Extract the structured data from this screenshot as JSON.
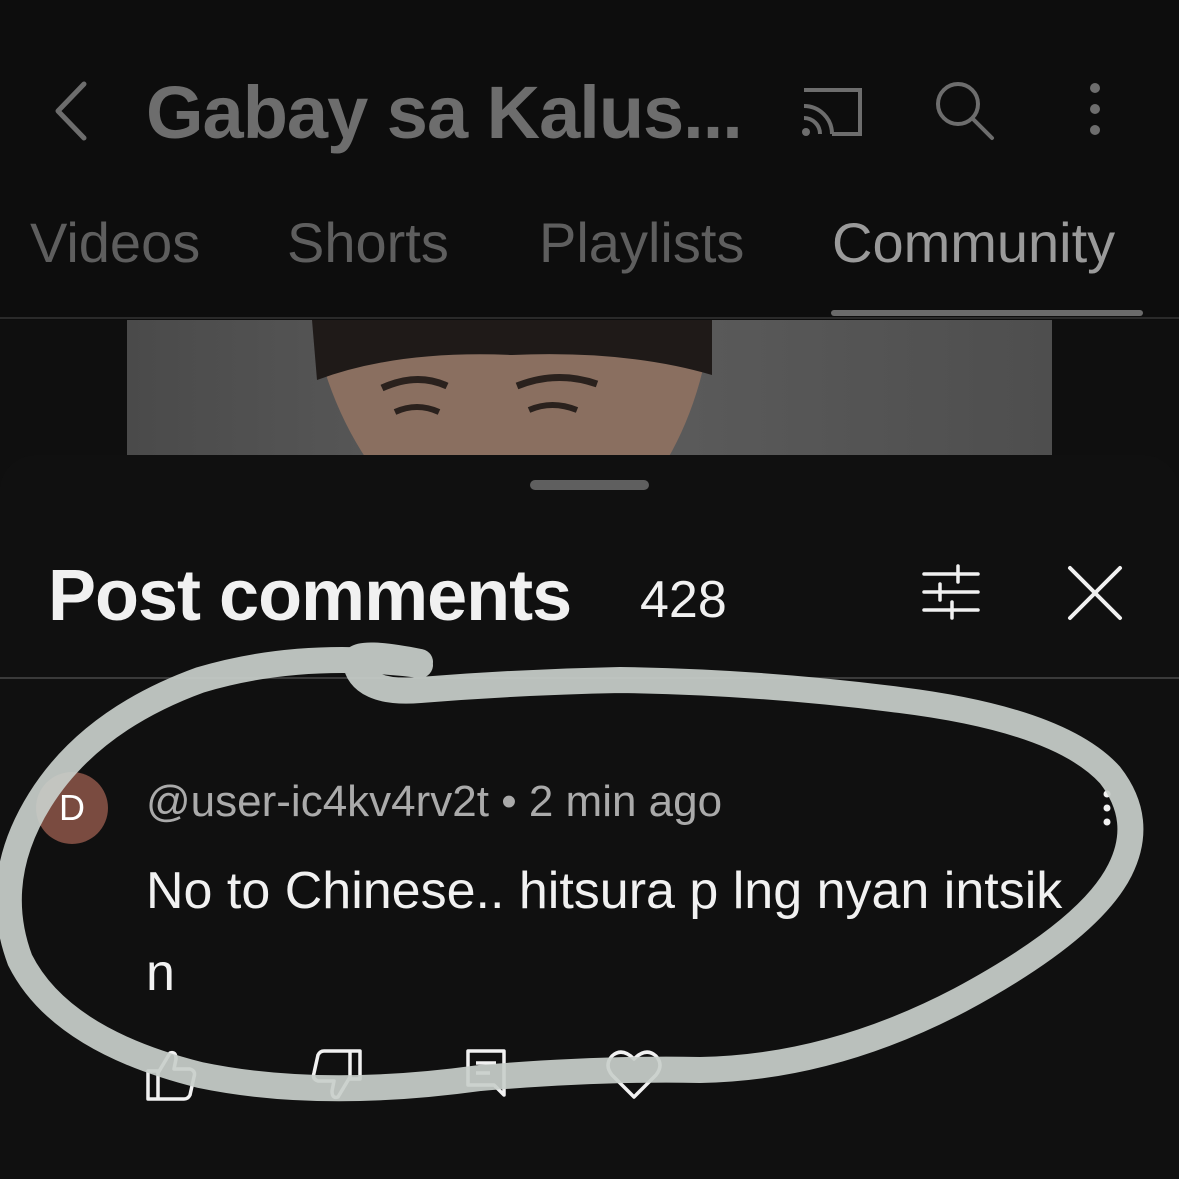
{
  "header": {
    "channel_title": "Gabay sa Kalus...",
    "icons": [
      "back-arrow-icon",
      "cast-icon",
      "search-icon",
      "more-vert-icon"
    ]
  },
  "tabs": [
    {
      "label": "Videos",
      "active": false
    },
    {
      "label": "Shorts",
      "active": false
    },
    {
      "label": "Playlists",
      "active": false
    },
    {
      "label": "Community",
      "active": true
    }
  ],
  "sheet": {
    "title": "Post comments",
    "count": "428",
    "icons": [
      "filter-icon",
      "close-icon"
    ]
  },
  "comment": {
    "avatar_letter": "D",
    "avatar_color": "#7a4b40",
    "author": "@user-ic4kv4rv2t",
    "separator": "•",
    "time": "2 min ago",
    "text": "No to Chinese.. hitsura p lng nyan intsik n",
    "actions": [
      "like-icon",
      "dislike-icon",
      "reply-icon",
      "heart-icon"
    ]
  },
  "colors": {
    "background": "#0f0f0f",
    "text_primary": "#f1f1f1",
    "text_secondary": "#aaaaaa",
    "scribble": "#c9cfcb"
  }
}
